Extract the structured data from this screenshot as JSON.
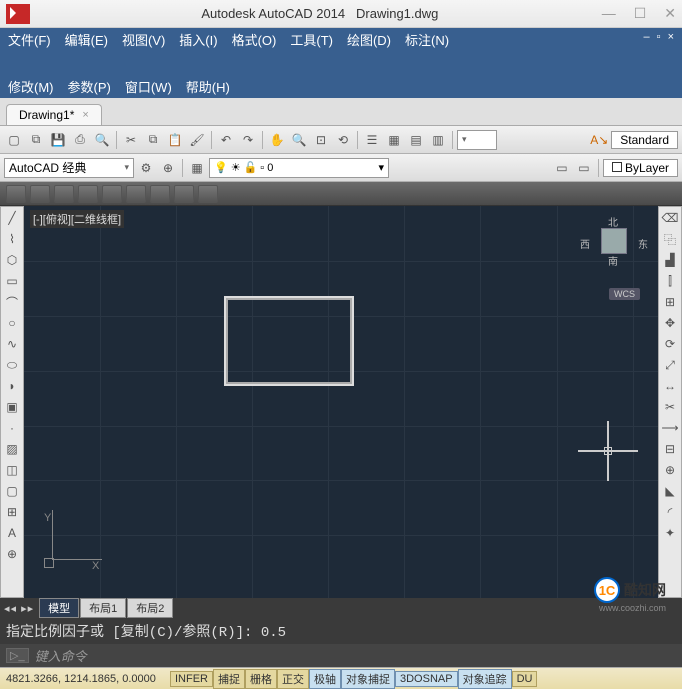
{
  "title": {
    "app": "Autodesk AutoCAD 2014",
    "file": "Drawing1.dwg"
  },
  "menu": {
    "row1": [
      "文件(F)",
      "编辑(E)",
      "视图(V)",
      "插入(I)",
      "格式(O)",
      "工具(T)",
      "绘图(D)",
      "标注(N)"
    ],
    "row2": [
      "修改(M)",
      "参数(P)",
      "窗口(W)",
      "帮助(H)"
    ]
  },
  "doc_tab": {
    "label": "Drawing1*",
    "close": "×"
  },
  "workspace": {
    "label": "AutoCAD 经典"
  },
  "styles": {
    "standard": "Standard",
    "bylayer": "ByLayer",
    "layerfield": "0"
  },
  "viewport": {
    "label": "[-][俯视][二维线框]"
  },
  "viewcube": {
    "n": "北",
    "s": "南",
    "w": "西",
    "e": "东",
    "wcs": "WCS"
  },
  "ucs": {
    "x": "X",
    "y": "Y"
  },
  "layout": {
    "tabs": [
      "模型",
      "布局1",
      "布局2"
    ]
  },
  "command": {
    "history": "指定比例因子或 [复制(C)/参照(R)]: 0.5",
    "prompt_icon": "▷_",
    "placeholder": "键入命令"
  },
  "status": {
    "coords": "4821.3266, 1214.1865, 0.0000",
    "toggles": [
      "INFER",
      "捕捉",
      "栅格",
      "正交",
      "极轴",
      "对象捕捉",
      "3DOSNAP",
      "对象追踪",
      "DU"
    ],
    "toggles_on": [
      4,
      5,
      6,
      7
    ]
  },
  "watermark": {
    "text": "酷知网",
    "url": "www.coozhi.com",
    "logo": "1C"
  }
}
